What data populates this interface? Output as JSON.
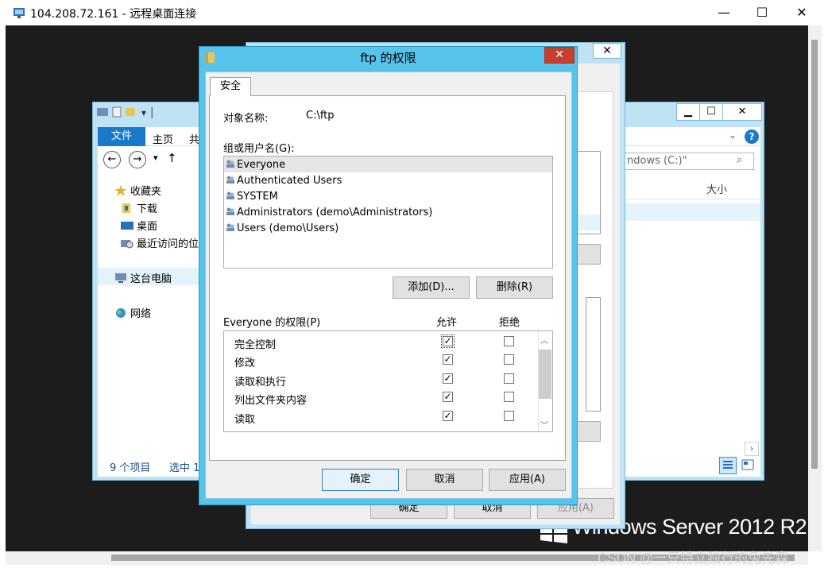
{
  "remote_desktop": {
    "title": "104.208.72.161 - 远程桌面连接",
    "minimize": "—",
    "maximize": "☐",
    "close": "✕"
  },
  "desktop": {
    "brand": "Windows Server 2012 R2",
    "watermark": "CSDN @一只特立独行的兔先森"
  },
  "explorer": {
    "quick_access": "▾ │",
    "ribbon_tabs": [
      "文件",
      "主页",
      "共"
    ],
    "search_placeholder": "ndows (C:)\"",
    "nav_tree": [
      "收藏夹",
      "下载",
      "桌面",
      "最近访问的位",
      "这台电脑",
      "网络"
    ],
    "columns": {
      "size": "大小"
    },
    "status_count": "9 个项目",
    "status_selected": "选中 1",
    "controls": {
      "min": "▁",
      "max": "☐",
      "close": "✕"
    }
  },
  "properties_window": {
    "close": "✕",
    "buttons": {
      "ok": "确定",
      "cancel": "取消",
      "apply": "应用(A)"
    }
  },
  "permissions_dialog": {
    "title": "ftp 的权限",
    "close": "✕",
    "tab": "安全",
    "object_name_label": "对象名称:",
    "object_name_value": "C:\\ftp",
    "group_label": "组或用户名(G):",
    "users": [
      "Everyone",
      "Authenticated Users",
      "SYSTEM",
      "Administrators (demo\\Administrators)",
      "Users (demo\\Users)"
    ],
    "selected_user": "Everyone",
    "add_button": "添加(D)...",
    "remove_button": "删除(R)",
    "permissions_label": "Everyone 的权限(P)",
    "allow_header": "允许",
    "deny_header": "拒绝",
    "permissions": [
      {
        "name": "完全控制",
        "allow": true,
        "deny": false
      },
      {
        "name": "修改",
        "allow": true,
        "deny": false
      },
      {
        "name": "读取和执行",
        "allow": true,
        "deny": false
      },
      {
        "name": "列出文件夹内容",
        "allow": true,
        "deny": false
      },
      {
        "name": "读取",
        "allow": true,
        "deny": false
      }
    ],
    "ok_button": "确定",
    "cancel_button": "取消",
    "apply_button": "应用(A)"
  }
}
